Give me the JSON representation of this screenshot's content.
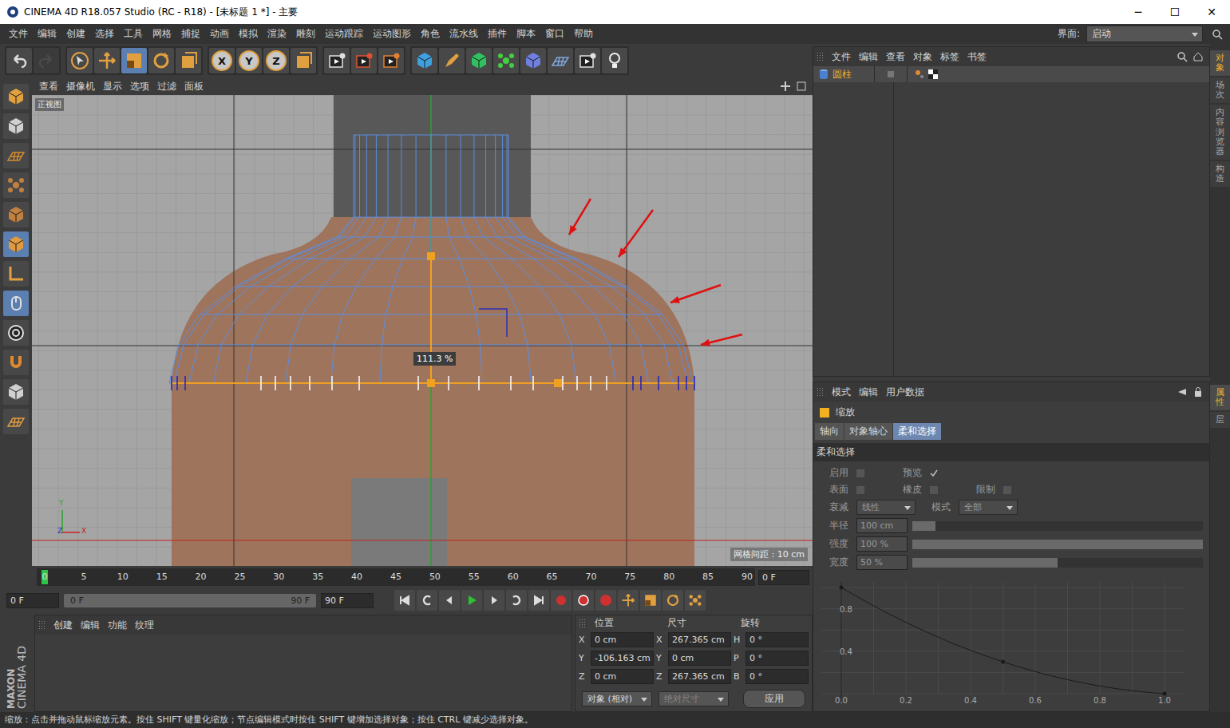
{
  "window": {
    "title": "CINEMA 4D R18.057 Studio (RC - R18) - [未标题 1 *] - 主要",
    "controls": [
      "─",
      "☐",
      "✕"
    ]
  },
  "menu": [
    "文件",
    "编辑",
    "创建",
    "选择",
    "工具",
    "网格",
    "捕捉",
    "动画",
    "模拟",
    "渲染",
    "雕刻",
    "运动跟踪",
    "运动图形",
    "角色",
    "流水线",
    "插件",
    "脚本",
    "窗口",
    "帮助"
  ],
  "layout_switch": {
    "label": "界面:",
    "value": "启动"
  },
  "toolbar": {
    "history": [
      {
        "kind": "undo",
        "disabled": false
      },
      {
        "kind": "redo",
        "disabled": true
      }
    ],
    "tools": [
      {
        "kind": "select",
        "selected": false
      },
      {
        "kind": "move",
        "selected": false
      },
      {
        "kind": "scale",
        "selected": true
      },
      {
        "kind": "rotate",
        "selected": false
      },
      {
        "kind": "recent",
        "selected": false
      }
    ],
    "axis_locks": [
      {
        "label": "X",
        "on": true
      },
      {
        "label": "Y",
        "on": true
      },
      {
        "label": "Z",
        "on": true
      }
    ]
  },
  "mode_tools": [
    {
      "kind": "model",
      "selected": false
    },
    {
      "kind": "texture",
      "selected": false
    },
    {
      "kind": "workplane",
      "selected": false
    },
    {
      "kind": "points",
      "selected": false
    },
    {
      "kind": "edges",
      "selected": false
    },
    {
      "kind": "polygons",
      "selected": true
    },
    {
      "kind": "axis",
      "selected": false
    },
    {
      "kind": "tweak",
      "selected": true
    },
    {
      "kind": "solo",
      "selected": false
    },
    {
      "kind": "snap",
      "selected": false
    },
    {
      "kind": "lock",
      "selected": false
    },
    {
      "kind": "planar",
      "selected": false
    }
  ],
  "viewport": {
    "menu": [
      "查看",
      "摄像机",
      "显示",
      "选项",
      "过滤",
      "面板"
    ],
    "view_label": "正视图",
    "scale_readout": "111.3 %",
    "grid_spacing": "网格间距 : 10 cm",
    "axes": [
      "Y",
      "Z",
      "X"
    ]
  },
  "timeline": {
    "ticks": [
      "0",
      "5",
      "10",
      "15",
      "20",
      "25",
      "30",
      "35",
      "40",
      "45",
      "50",
      "55",
      "60",
      "65",
      "70",
      "75",
      "80",
      "85",
      "90"
    ],
    "current": "0 F",
    "level": 0
  },
  "playback": {
    "start": "0 F",
    "range_start": "0 F",
    "range_end": "90 F",
    "end": "90 F"
  },
  "material_manager": {
    "menu": [
      "创建",
      "编辑",
      "功能",
      "纹理"
    ]
  },
  "coordinates": {
    "headers": [
      "位置",
      "尺寸",
      "旋转"
    ],
    "rows": [
      {
        "position_axis": "X",
        "position": "0 cm",
        "size_axis": "X",
        "size": "267.365 cm",
        "rotation_axis": "H",
        "rotation": "0 °"
      },
      {
        "position_axis": "Y",
        "position": "-106.163 cm",
        "size_axis": "Y",
        "size": "0 cm",
        "rotation_axis": "P",
        "rotation": "0 °"
      },
      {
        "position_axis": "Z",
        "position": "0 cm",
        "size_axis": "Z",
        "size": "267.365 cm",
        "rotation_axis": "B",
        "rotation": "0 °"
      }
    ],
    "mode": "对象 (相对)",
    "size_mode": "绝对尺寸",
    "size_mode_disabled": true,
    "apply": "应用"
  },
  "object_manager": {
    "menu": [
      "文件",
      "编辑",
      "查看",
      "对象",
      "标签",
      "书签"
    ],
    "objects": [
      {
        "name": "圆柱",
        "selected": true
      }
    ]
  },
  "attributes": {
    "menu": [
      "模式",
      "编辑",
      "用户数据"
    ],
    "title": "缩放",
    "tabs": [
      {
        "label": "轴向",
        "selected": false
      },
      {
        "label": "对象轴心",
        "selected": false
      },
      {
        "label": "柔和选择",
        "selected": true
      }
    ],
    "section": "柔和选择",
    "disabled": true,
    "check_rows": [
      [
        {
          "label": "启用",
          "checked": false
        },
        {
          "label": "预览",
          "checked": true
        }
      ],
      [
        {
          "label": "表面",
          "checked": false
        },
        {
          "label": "橡皮",
          "checked": false
        },
        {
          "label": "限制",
          "checked": false
        }
      ]
    ],
    "dropdowns": [
      {
        "label": "衰减",
        "value": "线性"
      },
      {
        "label": "模式",
        "value": "全部"
      }
    ],
    "sliders": [
      {
        "label": "半径",
        "reading": "100 cm",
        "level": 0.08
      },
      {
        "label": "强度",
        "reading": "100 %",
        "level": 1.0
      },
      {
        "label": "宽度",
        "reading": "50 %",
        "level": 0.5
      }
    ],
    "graph": {
      "x_ticks": [
        "0.0",
        "0.2",
        "0.4",
        "0.6",
        "0.8",
        "1.0"
      ],
      "y_ticks": [
        "0.8",
        "0.4"
      ],
      "x": [
        0,
        0.5,
        1
      ],
      "values": [
        1,
        0.3,
        0
      ]
    }
  },
  "dock_tabs_top": [
    {
      "label": "对象",
      "selected": true
    },
    {
      "label": "场次",
      "selected": false
    },
    {
      "label": "内容浏览器",
      "selected": false
    },
    {
      "label": "构造",
      "selected": false
    }
  ],
  "dock_tabs_bottom": [
    {
      "label": "属性",
      "selected": true
    },
    {
      "label": "层",
      "selected": false
    }
  ],
  "logo": [
    "MAXON",
    "CINEMA 4D"
  ],
  "status_bar": "缩放：点击并拖动鼠标缩放元素。按住 SHIFT 键量化缩放；节点编辑模式时按住 SHIFT 键增加选择对象；按住 CTRL 键减少选择对象。"
}
